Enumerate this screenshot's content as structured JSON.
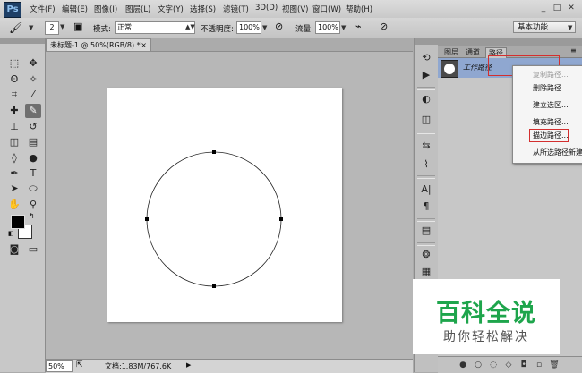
{
  "app": {
    "logo": "Ps"
  },
  "menubar": {
    "items": [
      "文件(F)",
      "编辑(E)",
      "图像(I)",
      "图层(L)",
      "文字(Y)",
      "选择(S)",
      "滤镜(T)",
      "3D(D)",
      "视图(V)",
      "窗口(W)",
      "帮助(H)"
    ],
    "minimize": "_",
    "maximize": "□",
    "close": "✕"
  },
  "options": {
    "brush_size": "2",
    "mode_label": "模式:",
    "mode_value": "正常",
    "opacity_label": "不透明度:",
    "opacity_value": "100%",
    "flow_label": "流量:",
    "flow_value": "100%",
    "workspace": "基本功能"
  },
  "document": {
    "tab_title": "未标题-1 @ 50%(RGB/8) *",
    "tab_close": "×",
    "zoom": "50%",
    "doc_info": "文档:1.83M/767.6K",
    "colors": {
      "canvas": "#ffffff",
      "workspace": "#b7b7b7",
      "foreground": "#000000",
      "background": "#ffffff"
    }
  },
  "panel": {
    "tabs": [
      "图层",
      "通道",
      "路径"
    ],
    "active_tab": "路径",
    "path_name": "工作路径",
    "selection_color": "#8fa7d0"
  },
  "context_menu": {
    "items": [
      {
        "label": "复制路径...",
        "disabled": true
      },
      {
        "label": "删除路径",
        "disabled": false
      },
      {
        "label": "建立选区...",
        "disabled": false
      },
      {
        "label": "填充路径...",
        "disabled": false
      },
      {
        "label": "描边路径...",
        "disabled": false,
        "highlighted": true
      },
      {
        "label": "从所选路径新建",
        "disabled": false
      }
    ],
    "highlight_color": "#d32f2f"
  },
  "watermark": {
    "title": "百科全说",
    "subtitle": "助你轻松解决",
    "title_color": "#1ea54c"
  },
  "icons": {
    "toolbox": [
      "marquee-icon",
      "move-icon",
      "lasso-icon",
      "magic-wand-icon",
      "crop-icon",
      "eyedropper-icon",
      "healing-icon",
      "brush-icon",
      "stamp-icon",
      "history-brush-icon",
      "eraser-icon",
      "gradient-icon",
      "blur-icon",
      "dodge-icon",
      "pen-icon",
      "type-icon",
      "path-select-icon",
      "shape-icon",
      "hand-icon",
      "zoom-icon"
    ]
  }
}
